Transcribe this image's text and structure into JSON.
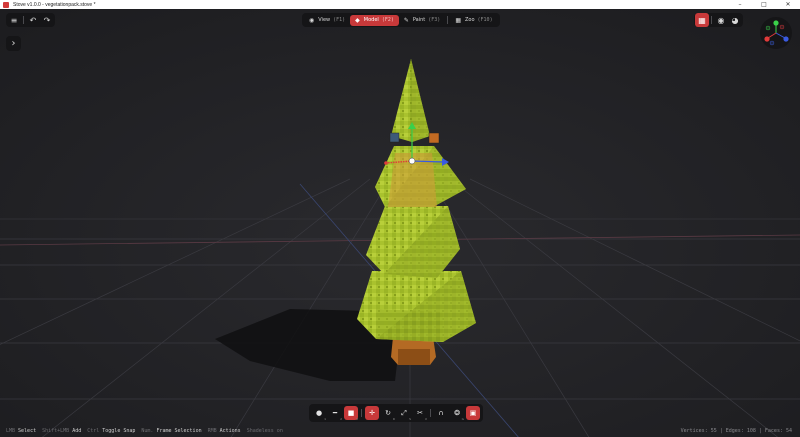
{
  "window": {
    "title": "Stove v1.0.0 - vegetationpack.stove *",
    "minimize": "–",
    "maximize": "□",
    "close": "✕"
  },
  "top_left": {
    "menu_icon": "≡",
    "undo_icon": "↶",
    "redo_icon": "↷",
    "console_icon": "›"
  },
  "modes": [
    {
      "icon": "◉",
      "label": "View",
      "key": "(F1)",
      "active": false
    },
    {
      "icon": "◆",
      "label": "Model",
      "key": "(F2)",
      "active": true
    },
    {
      "icon": "✎",
      "label": "Paint",
      "key": "(F3)",
      "active": false
    },
    {
      "icon": "▦",
      "label": "Zoo",
      "key": "(F10)",
      "active": false
    }
  ],
  "top_right": {
    "grid_icon": "▦",
    "eye_icon": "◉",
    "globe_icon": "◕"
  },
  "tools": [
    {
      "icon": "●",
      "sub": "1",
      "active": false
    },
    {
      "icon": "━",
      "sub": "2",
      "active": false
    },
    {
      "icon": "■",
      "sub": "3",
      "active": true
    },
    {
      "icon": "✛",
      "sub": "",
      "active": true
    },
    {
      "icon": "↻",
      "sub": "R",
      "active": false
    },
    {
      "icon": "⤢",
      "sub": "S",
      "active": false
    },
    {
      "icon": "✂",
      "sub": "X",
      "active": false
    },
    {
      "icon": "∩",
      "sub": "",
      "active": false
    },
    {
      "icon": "❂",
      "sub": "G",
      "active": false
    },
    {
      "icon": "▣",
      "sub": "",
      "active": true
    }
  ],
  "status": {
    "hints": [
      {
        "key": "LMB",
        "action": "Select"
      },
      {
        "key": "Shift+LMB",
        "action": "Add"
      },
      {
        "key": "Ctrl",
        "action": "Toggle Snap"
      },
      {
        "key": "Num.",
        "action": "Frame Selection"
      },
      {
        "key": "RMB",
        "action": "Actions"
      },
      {
        "key": "Shadeless on",
        "action": ""
      }
    ],
    "stats": "Vertices: 55 | Edges: 108 | Faces: 54"
  },
  "colors": {
    "accent": "#c8393a",
    "foliage": "#a9c22e",
    "foliage_dark": "#7f9a1c",
    "trunk": "#b46a24",
    "selection": "#d49a3a",
    "axis_x": "#e03a3a",
    "axis_y": "#3ad04a",
    "axis_z": "#3a5ae0"
  },
  "icons": {
    "menu": "hamburger-icon",
    "undo": "undo-icon",
    "redo": "redo-icon",
    "console": "chevron-right-icon",
    "grid": "grid-icon",
    "eye": "eye-icon",
    "globe": "globe-icon"
  }
}
